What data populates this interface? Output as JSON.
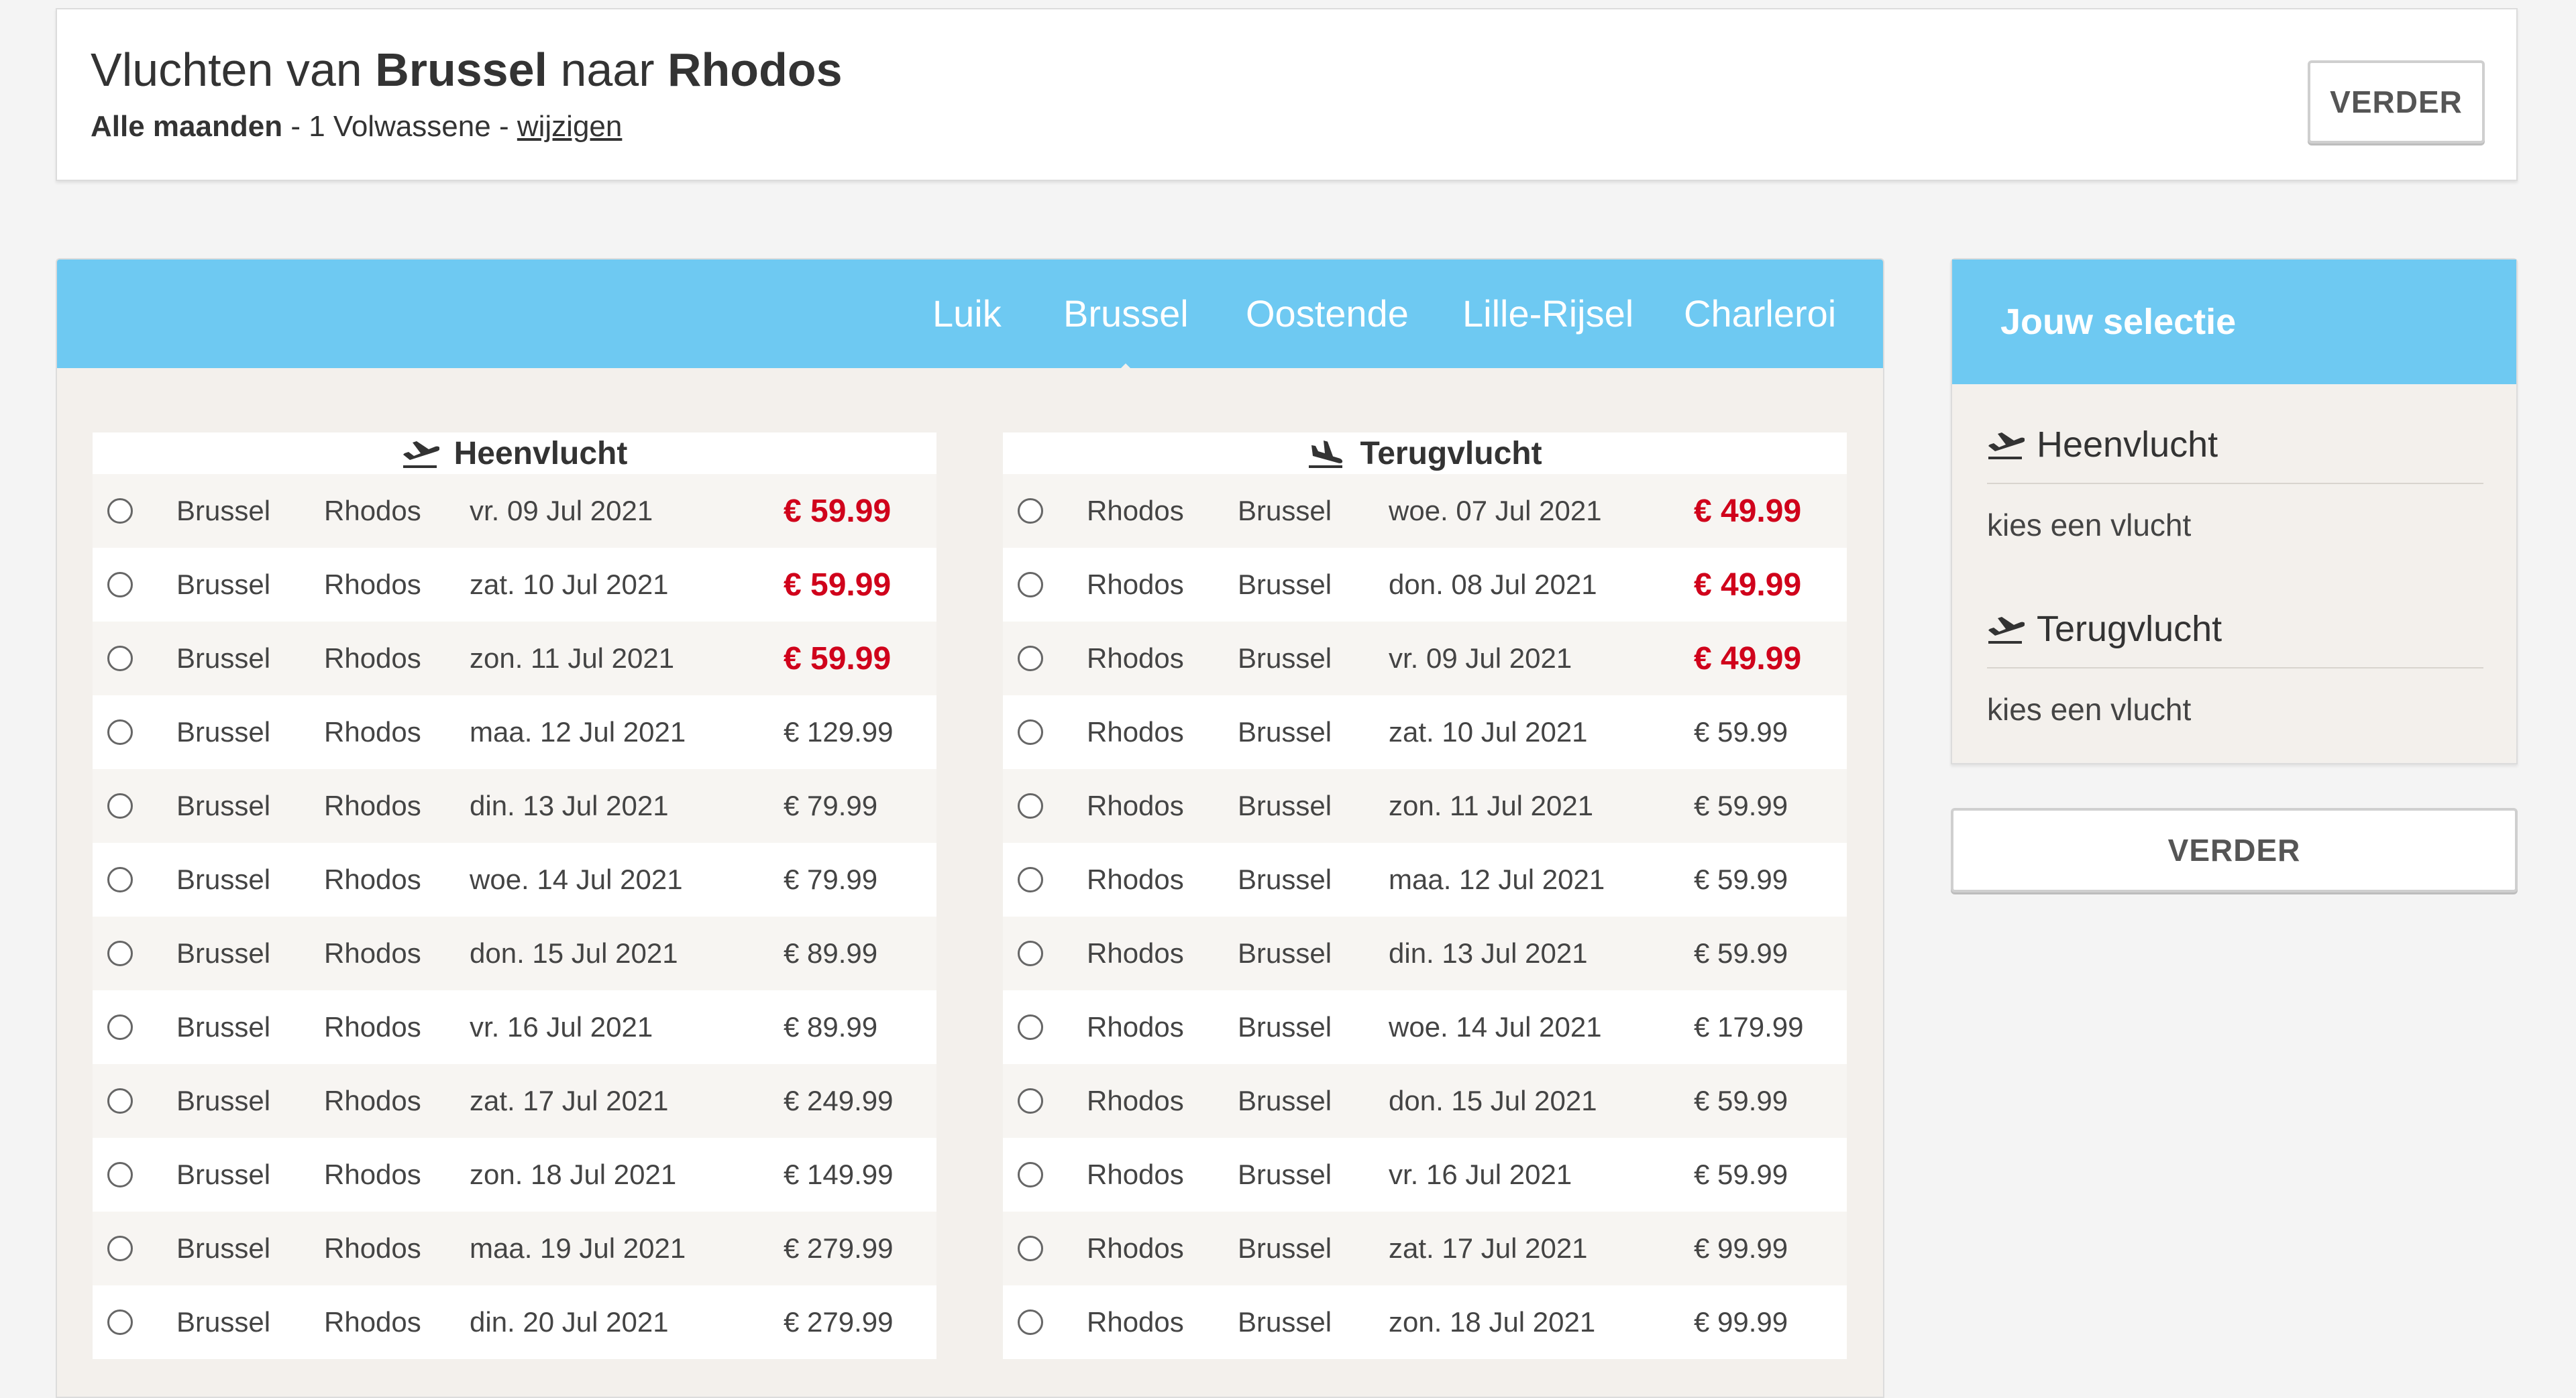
{
  "header": {
    "title_prefix": "Vluchten van",
    "from": "Brussel",
    "title_mid": "naar",
    "to": "Rhodos",
    "months": "Alle maanden",
    "sep1": " - ",
    "passengers": "1 Volwassene",
    "sep2": " - ",
    "change_link": "wijzigen",
    "continue_label": "VERDER"
  },
  "airport_tabs": [
    {
      "label": "Luik",
      "active": false
    },
    {
      "label": "Brussel",
      "active": true
    },
    {
      "label": "Oostende",
      "active": false
    },
    {
      "label": "Lille-Rijsel",
      "active": false
    },
    {
      "label": "Charleroi",
      "active": false
    }
  ],
  "outbound": {
    "heading": "Heenvlucht",
    "icon": "plane-takeoff-icon",
    "rows": [
      {
        "from": "Brussel",
        "to": "Rhodos",
        "date": "vr. 09 Jul 2021",
        "price": "€ 59.99",
        "highlight": true
      },
      {
        "from": "Brussel",
        "to": "Rhodos",
        "date": "zat. 10 Jul 2021",
        "price": "€ 59.99",
        "highlight": true
      },
      {
        "from": "Brussel",
        "to": "Rhodos",
        "date": "zon. 11 Jul 2021",
        "price": "€ 59.99",
        "highlight": true
      },
      {
        "from": "Brussel",
        "to": "Rhodos",
        "date": "maa. 12 Jul 2021",
        "price": "€ 129.99",
        "highlight": false
      },
      {
        "from": "Brussel",
        "to": "Rhodos",
        "date": "din. 13 Jul 2021",
        "price": "€ 79.99",
        "highlight": false
      },
      {
        "from": "Brussel",
        "to": "Rhodos",
        "date": "woe. 14 Jul 2021",
        "price": "€ 79.99",
        "highlight": false
      },
      {
        "from": "Brussel",
        "to": "Rhodos",
        "date": "don. 15 Jul 2021",
        "price": "€ 89.99",
        "highlight": false
      },
      {
        "from": "Brussel",
        "to": "Rhodos",
        "date": "vr. 16 Jul 2021",
        "price": "€ 89.99",
        "highlight": false
      },
      {
        "from": "Brussel",
        "to": "Rhodos",
        "date": "zat. 17 Jul 2021",
        "price": "€ 249.99",
        "highlight": false
      },
      {
        "from": "Brussel",
        "to": "Rhodos",
        "date": "zon. 18 Jul 2021",
        "price": "€ 149.99",
        "highlight": false
      },
      {
        "from": "Brussel",
        "to": "Rhodos",
        "date": "maa. 19 Jul 2021",
        "price": "€ 279.99",
        "highlight": false
      },
      {
        "from": "Brussel",
        "to": "Rhodos",
        "date": "din. 20 Jul 2021",
        "price": "€ 279.99",
        "highlight": false
      }
    ]
  },
  "return": {
    "heading": "Terugvlucht",
    "icon": "plane-landing-icon",
    "rows": [
      {
        "from": "Rhodos",
        "to": "Brussel",
        "date": "woe. 07 Jul 2021",
        "price": "€ 49.99",
        "highlight": true
      },
      {
        "from": "Rhodos",
        "to": "Brussel",
        "date": "don. 08 Jul 2021",
        "price": "€ 49.99",
        "highlight": true
      },
      {
        "from": "Rhodos",
        "to": "Brussel",
        "date": "vr. 09 Jul 2021",
        "price": "€ 49.99",
        "highlight": true
      },
      {
        "from": "Rhodos",
        "to": "Brussel",
        "date": "zat. 10 Jul 2021",
        "price": "€ 59.99",
        "highlight": false
      },
      {
        "from": "Rhodos",
        "to": "Brussel",
        "date": "zon. 11 Jul 2021",
        "price": "€ 59.99",
        "highlight": false
      },
      {
        "from": "Rhodos",
        "to": "Brussel",
        "date": "maa. 12 Jul 2021",
        "price": "€ 59.99",
        "highlight": false
      },
      {
        "from": "Rhodos",
        "to": "Brussel",
        "date": "din. 13 Jul 2021",
        "price": "€ 59.99",
        "highlight": false
      },
      {
        "from": "Rhodos",
        "to": "Brussel",
        "date": "woe. 14 Jul 2021",
        "price": "€ 179.99",
        "highlight": false
      },
      {
        "from": "Rhodos",
        "to": "Brussel",
        "date": "don. 15 Jul 2021",
        "price": "€ 59.99",
        "highlight": false
      },
      {
        "from": "Rhodos",
        "to": "Brussel",
        "date": "vr. 16 Jul 2021",
        "price": "€ 59.99",
        "highlight": false
      },
      {
        "from": "Rhodos",
        "to": "Brussel",
        "date": "zat. 17 Jul 2021",
        "price": "€ 99.99",
        "highlight": false
      },
      {
        "from": "Rhodos",
        "to": "Brussel",
        "date": "zon. 18 Jul 2021",
        "price": "€ 99.99",
        "highlight": false
      }
    ]
  },
  "selection": {
    "title": "Jouw selectie",
    "outbound_label": "Heenvlucht",
    "outbound_note": "kies een vlucht",
    "return_label": "Terugvlucht",
    "return_note": "kies een vlucht",
    "continue_label": "VERDER"
  },
  "colors": {
    "accent_blue": "#6ec9f2",
    "price_red": "#d0021b",
    "panel_bg": "#f3f0ec"
  }
}
